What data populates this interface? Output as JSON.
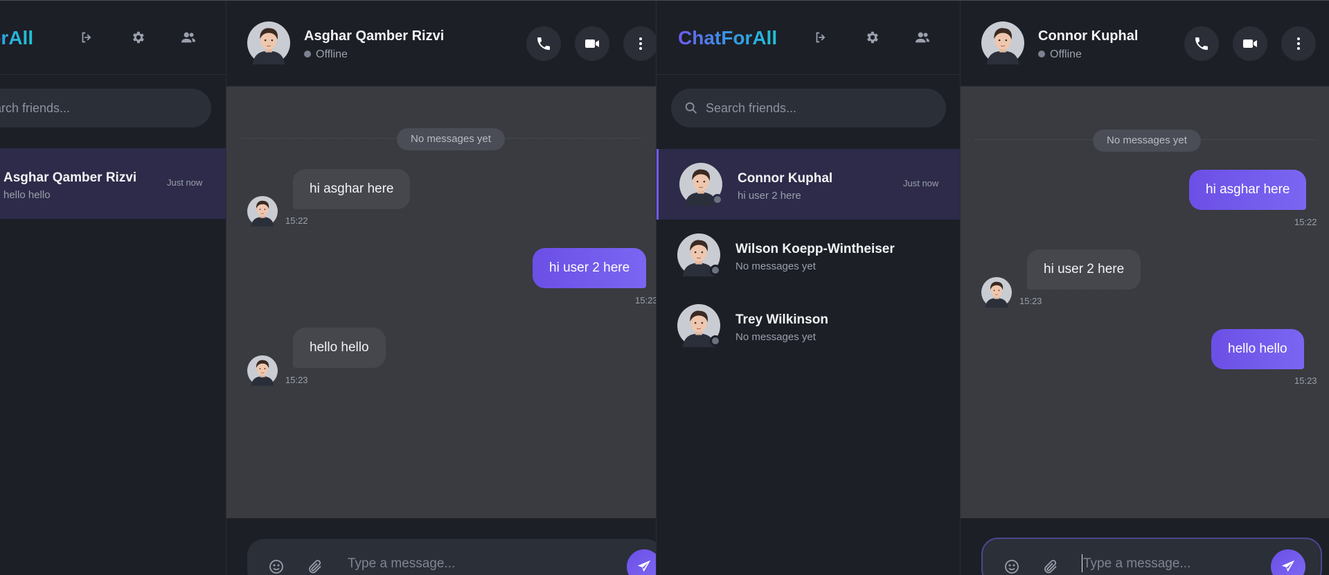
{
  "app": {
    "logo": "ChatForAll"
  },
  "sidebar": {
    "search_placeholder": "Search friends...",
    "icons": [
      "logout-icon",
      "gear-icon",
      "users-icon"
    ]
  },
  "windowA": {
    "contacts": [
      {
        "name": "Asghar Qamber Rizvi",
        "last": "hello hello",
        "time": "Just now",
        "active": true
      }
    ],
    "header": {
      "name": "Asghar Qamber Rizvi",
      "status": "Offline"
    },
    "divider": "No messages yet",
    "messages": [
      {
        "text": "hi asghar here",
        "time": "15:22",
        "dir": "in"
      },
      {
        "text": "hi user 2 here",
        "time": "15:23",
        "dir": "out"
      },
      {
        "text": "hello hello",
        "time": "15:23",
        "dir": "in"
      }
    ],
    "composer_placeholder": "Type a message..."
  },
  "windowB": {
    "contacts": [
      {
        "name": "Connor Kuphal",
        "last": "hi user 2 here",
        "time": "Just now",
        "active": true
      },
      {
        "name": "Wilson Koepp-Wintheiser",
        "last": "No messages yet",
        "time": ""
      },
      {
        "name": "Trey Wilkinson",
        "last": "No messages yet",
        "time": ""
      }
    ],
    "header": {
      "name": "Connor Kuphal",
      "status": "Offline"
    },
    "divider": "No messages yet",
    "messages": [
      {
        "text": "hi asghar here",
        "time": "15:22",
        "dir": "out"
      },
      {
        "text": "hi user 2 here",
        "time": "15:23",
        "dir": "in"
      },
      {
        "text": "hello hello",
        "time": "15:23",
        "dir": "out"
      }
    ],
    "composer_placeholder": "Type a message..."
  },
  "colors": {
    "accent": "#6c4fe6",
    "sidebar_bg": "#1c1f26",
    "chat_bg": "#393b40",
    "active_row": "#2d2b49"
  }
}
